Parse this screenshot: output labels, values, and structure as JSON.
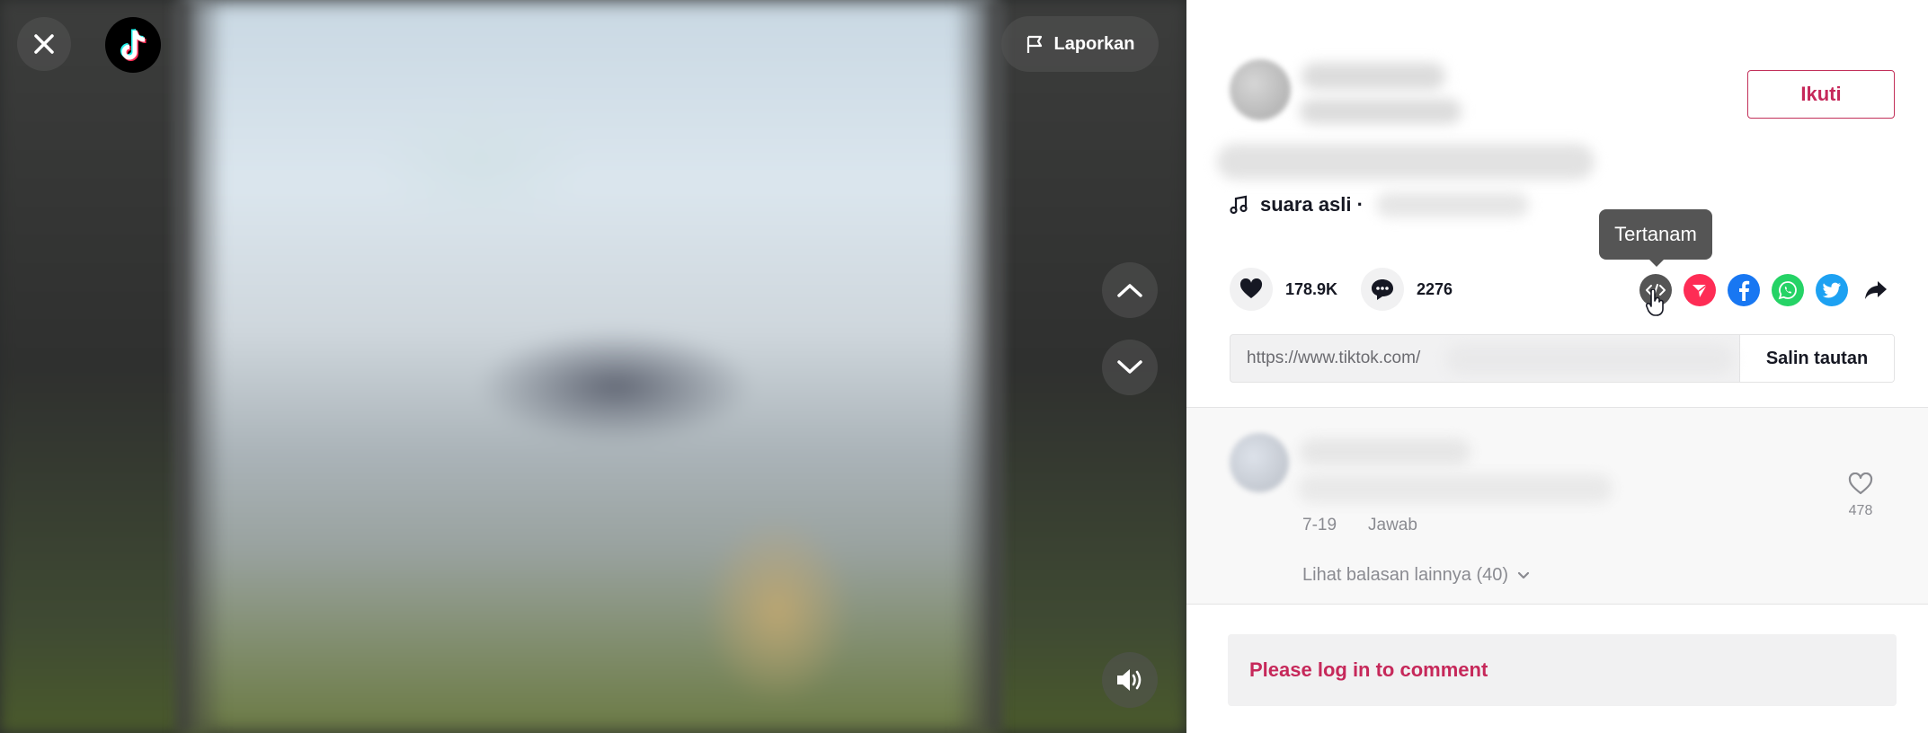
{
  "header": {
    "close_icon": "close-icon",
    "logo_icon": "tiktok-logo-icon",
    "report_label": "Laporkan"
  },
  "video_nav": {
    "prev_icon": "chevron-up-icon",
    "next_icon": "chevron-down-icon",
    "sound_icon": "speaker-icon"
  },
  "author": {
    "follow_label": "Ikuti"
  },
  "music": {
    "label": "suara asli ·"
  },
  "stats": {
    "likes": "178.9K",
    "comments": "2276"
  },
  "share": {
    "tooltip": "Tertanam",
    "icons": [
      "embed-icon",
      "send-icon",
      "facebook-icon",
      "whatsapp-icon",
      "twitter-icon",
      "share-arrow-icon"
    ]
  },
  "link": {
    "url": "https://www.tiktok.com/",
    "copy_label": "Salin tautan"
  },
  "comment": {
    "date": "7-19",
    "reply_label": "Jawab",
    "like_count": "478",
    "more_replies": "Lihat balasan lainnya (40)"
  },
  "login": {
    "prompt": "Please log in to comment"
  },
  "colors": {
    "accent": "#c6285a",
    "facebook": "#1877f2",
    "whatsapp": "#25d366",
    "twitter": "#1da1f2",
    "send": "#fe2c55"
  }
}
